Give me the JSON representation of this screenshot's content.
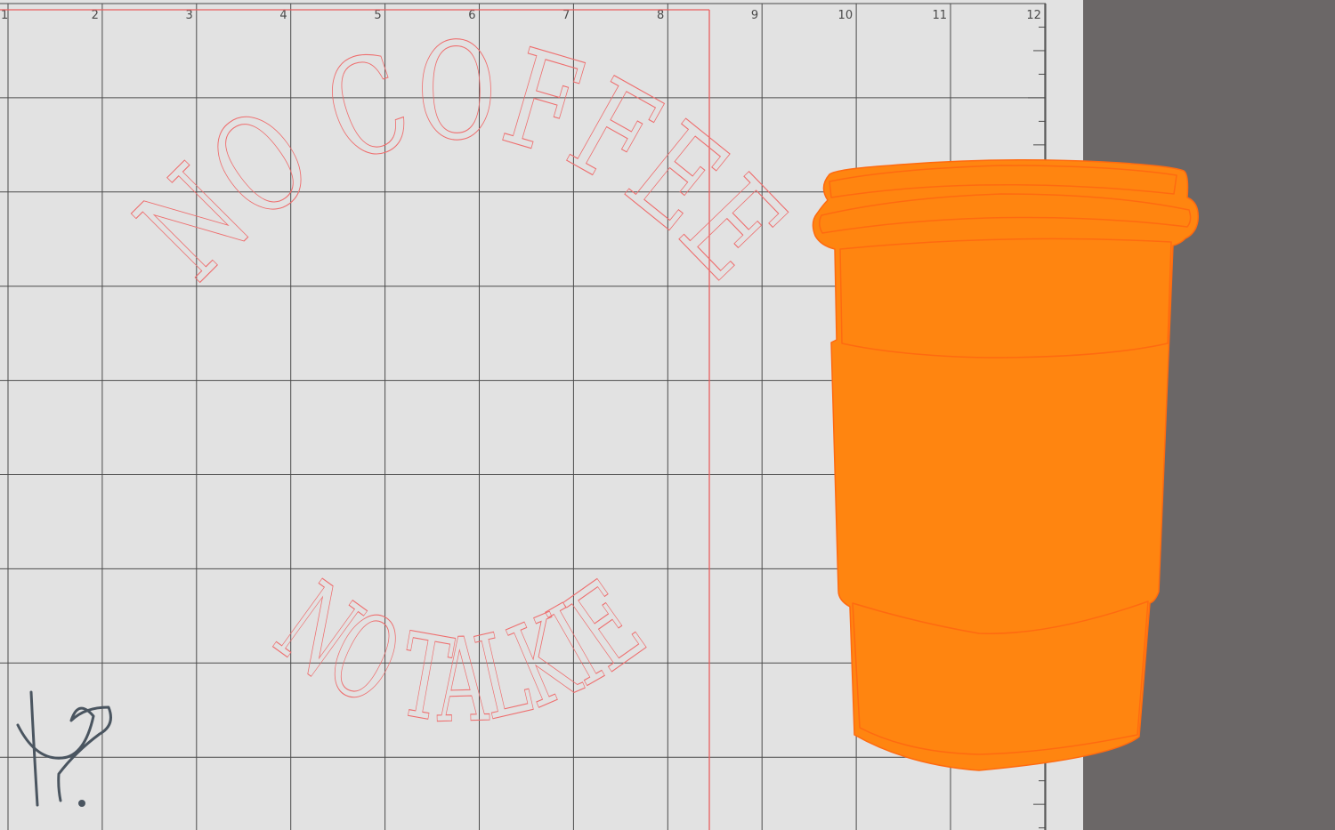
{
  "canvas": {
    "colors": {
      "mat_background": "#e2e2e2",
      "grid_line": "#4b4b4b",
      "cut_boundary": "#e86060",
      "workspace_panel": "#6b6767",
      "design_outline": "#ee6e6e",
      "cup_fill": "#ff8510",
      "cup_stroke": "#ff6a10",
      "signature_stroke": "#4a5560"
    },
    "ruler": {
      "numbers": [
        "1",
        "2",
        "3",
        "4",
        "5",
        "6",
        "7",
        "8",
        "9",
        "10",
        "11",
        "12"
      ]
    }
  },
  "design": {
    "top_text": "NO COFFEE",
    "bottom_text": "NO TALKIE",
    "cup_icon": "coffee-cup-icon",
    "signature_icon": "signature-logo-icon"
  }
}
